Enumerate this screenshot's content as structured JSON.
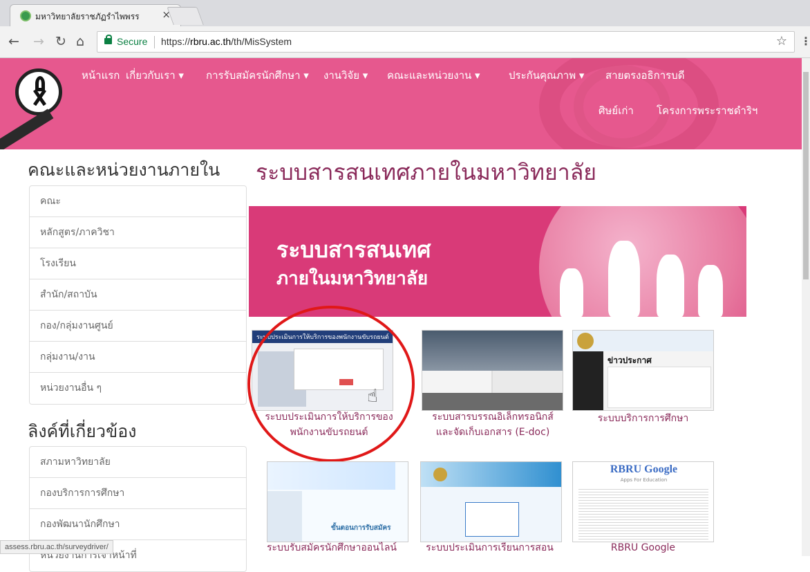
{
  "browser": {
    "tab_title": "มหาวิทยาลัยราชภัฏรำไพพรร",
    "tab_close": "×",
    "secure_label": "Secure",
    "url_prefix": "https://",
    "url_host": "rbru.ac.th",
    "url_path": "/th/MisSystem",
    "status_url": "assess.rbru.ac.th/surveydriver/"
  },
  "header": {
    "nav": [
      "หน้าแรก",
      "เกี่ยวกับเรา ▾",
      "การรับสมัครนักศึกษา ▾",
      "งานวิจัย ▾",
      "คณะและหน่วยงาน ▾",
      "ประกันคุณภาพ ▾",
      "สายตรงอธิการบดี"
    ],
    "nav_row2": [
      "ศิษย์เก่า",
      "โครงการพระราชดำริฯ"
    ],
    "color": "#e6588e"
  },
  "sidebar": {
    "heading1": "คณะและหน่วยงานภายใน",
    "items1": [
      "คณะ",
      "หลักสูตร/ภาควิชา",
      "โรงเรียน",
      "สำนัก/สถาบัน",
      "กอง/กลุ่มงานศูนย์",
      "กลุ่มงาน/งาน",
      "หน่วยงานอื่น ๆ"
    ],
    "heading2": "ลิงค์ที่เกี่ยวข้อง",
    "items2": [
      "สภามหาวิทยาลัย",
      "กองบริการการศึกษา",
      "กองพัฒนานักศึกษา",
      "หน่วยงานการเจ้าหน้าที่"
    ]
  },
  "main": {
    "title": "ระบบสารสนเทศภายในมหาวิทยาลัย",
    "banner_line1": "ระบบสารสนเทศ",
    "banner_line2": "ภายในมหาวิทยาลัย",
    "cards": [
      {
        "caption1": "ระบบประเมินการให้บริการของ",
        "caption2": "พนักงานขับรถยนต์",
        "thumb_header": "ระบบประเมินการให้บริการของพนักงานขับรถยนต์"
      },
      {
        "caption1": "ระบบสารบรรณอิเล็กทรอนิกส์",
        "caption2": "และจัดเก็บเอกสาร (E-doc)"
      },
      {
        "caption1": "ระบบบริการการศึกษา",
        "caption2": "",
        "thumb_header": "ข่าวประกาศ"
      },
      {
        "caption1": "ระบบรับสมัครนักศึกษาออนไลน์",
        "caption2": "",
        "thumb_header": "ขั้นตอนการรับสมัคร"
      },
      {
        "caption1": "ระบบประเมินการเรียนการสอน",
        "caption2": ""
      },
      {
        "caption1": "RBRU Google",
        "caption2": "",
        "thumb_header": "RBRU Google",
        "thumb_sub": "Apps For Education"
      }
    ]
  }
}
